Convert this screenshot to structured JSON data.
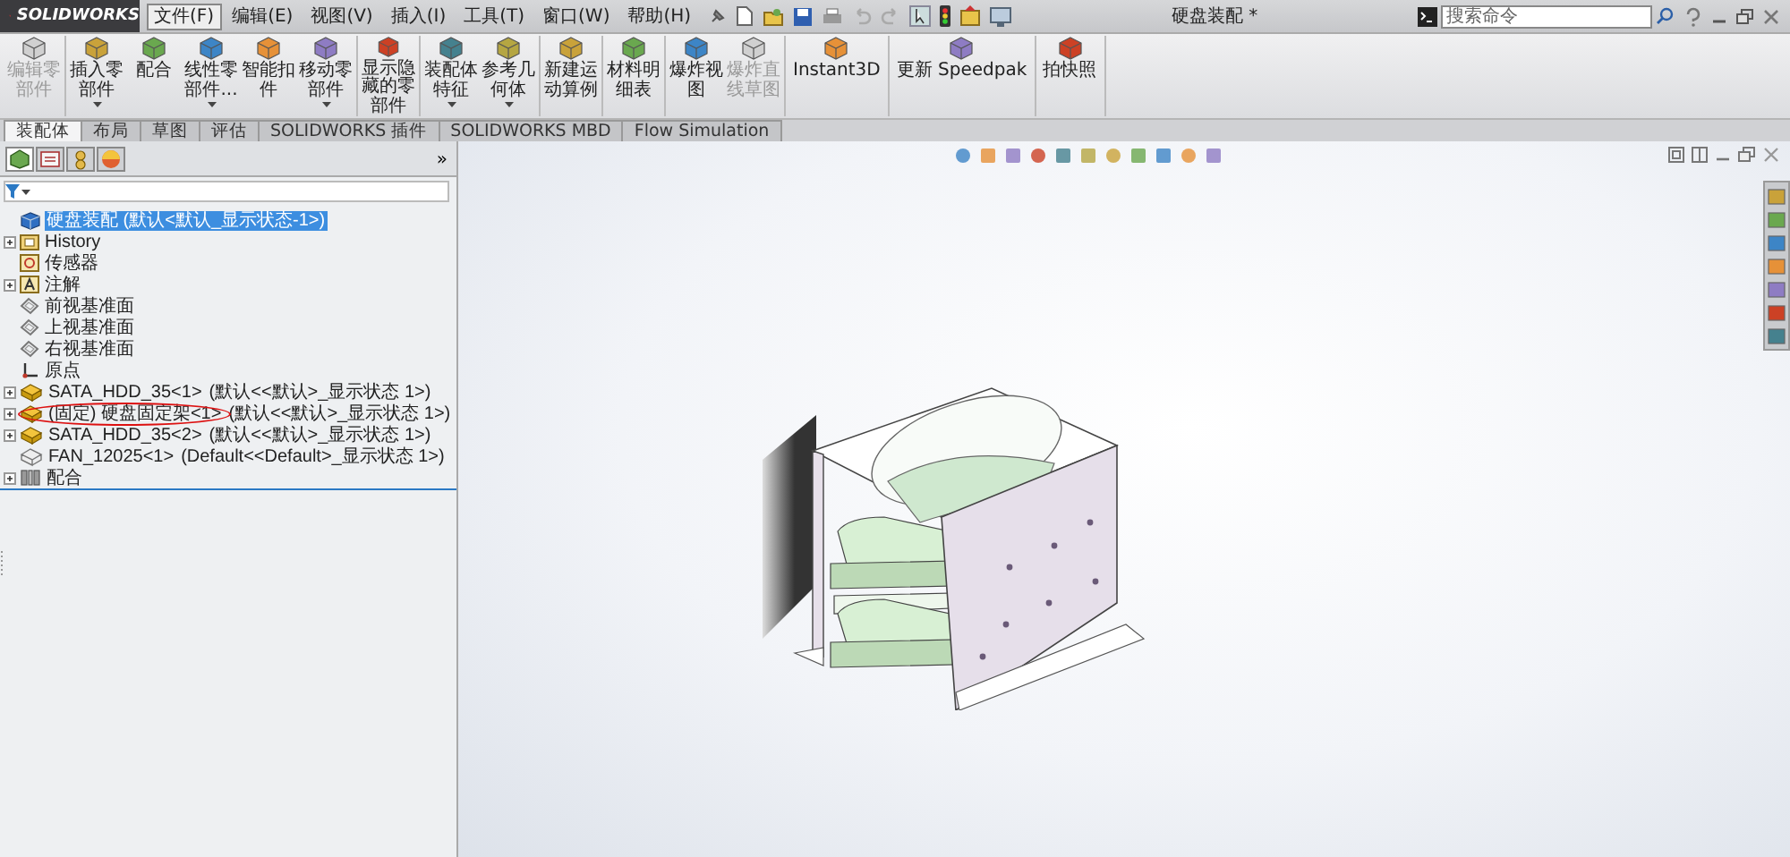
{
  "app": {
    "logo": "SOLIDWORKS"
  },
  "menu": [
    {
      "label": "文件(F)",
      "selected": true
    },
    {
      "label": "编辑(E)",
      "selected": false
    },
    {
      "label": "视图(V)",
      "selected": false
    },
    {
      "label": "插入(I)",
      "selected": false
    },
    {
      "label": "工具(T)",
      "selected": false
    },
    {
      "label": "窗口(W)",
      "selected": false
    },
    {
      "label": "帮助(H)",
      "selected": false
    }
  ],
  "window": {
    "title": "硬盘装配 *"
  },
  "search": {
    "placeholder": "搜索命令"
  },
  "ribbon": [
    [
      {
        "label": "编辑零部件",
        "disabled": true,
        "dropdown": false
      }
    ],
    [
      {
        "label": "插入零部件",
        "disabled": false,
        "dropdown": true
      },
      {
        "label": "配合",
        "disabled": false,
        "dropdown": false
      },
      {
        "label": "线性零部件...",
        "disabled": false,
        "dropdown": true
      },
      {
        "label": "智能扣件",
        "disabled": false,
        "dropdown": false
      },
      {
        "label": "移动零部件",
        "disabled": false,
        "dropdown": true
      }
    ],
    [
      {
        "label": "显示隐藏的零部件",
        "disabled": false,
        "dropdown": false
      }
    ],
    [
      {
        "label": "装配体特征",
        "disabled": false,
        "dropdown": true
      },
      {
        "label": "参考几何体",
        "disabled": false,
        "dropdown": true
      }
    ],
    [
      {
        "label": "新建运动算例",
        "disabled": false,
        "dropdown": false
      }
    ],
    [
      {
        "label": "材料明细表",
        "disabled": false,
        "dropdown": false
      }
    ],
    [
      {
        "label": "爆炸视图",
        "disabled": false,
        "dropdown": false
      },
      {
        "label": "爆炸直线草图",
        "disabled": true,
        "dropdown": false
      }
    ],
    [
      {
        "label": "Instant3D",
        "disabled": false,
        "dropdown": false
      }
    ],
    [
      {
        "label": "更新 Speedpak",
        "disabled": false,
        "dropdown": false
      }
    ],
    [
      {
        "label": "拍快照",
        "disabled": false,
        "dropdown": false
      }
    ]
  ],
  "tabs": [
    {
      "label": "装配体",
      "selected": true
    },
    {
      "label": "布局",
      "selected": false
    },
    {
      "label": "草图",
      "selected": false
    },
    {
      "label": "评估",
      "selected": false
    },
    {
      "label": "SOLIDWORKS 插件",
      "selected": false
    },
    {
      "label": "SOLIDWORKS MBD",
      "selected": false
    },
    {
      "label": "Flow Simulation",
      "selected": false
    }
  ],
  "panel": {
    "tabs": [
      {
        "kind": "tree",
        "selected": true
      },
      {
        "kind": "property",
        "selected": false
      },
      {
        "kind": "config",
        "selected": false
      },
      {
        "kind": "display",
        "selected": false
      }
    ],
    "more": "»"
  },
  "tree": [
    {
      "label": "硬盘装配 (默认<默认_显示状态-1>)",
      "kind": "assembly",
      "selected": true,
      "children": [
        {
          "label": "History",
          "kind": "history",
          "selected": false,
          "expanded": false
        },
        {
          "label": "传感器",
          "kind": "sensor",
          "selected": false
        },
        {
          "label": "注解",
          "kind": "annotation",
          "selected": false,
          "expanded": false
        },
        {
          "label": "前视基准面",
          "kind": "plane",
          "selected": false
        },
        {
          "label": "上视基准面",
          "kind": "plane",
          "selected": false
        },
        {
          "label": "右视基准面",
          "kind": "plane",
          "selected": false
        },
        {
          "label": "原点",
          "kind": "origin",
          "selected": false
        },
        {
          "label": "SATA_HDD_35<1>",
          "config": "(默认<<默认>_显示状态 1>)",
          "kind": "part",
          "selected": false,
          "expanded": false
        },
        {
          "label": "(固定) 硬盘固定架<1>",
          "config": "(默认<<默认>_显示状态 1>)",
          "kind": "part",
          "selected": false,
          "expanded": false,
          "circled": true
        },
        {
          "label": "SATA_HDD_35<2>",
          "config": "(默认<<默认>_显示状态 1>)",
          "kind": "part",
          "selected": false,
          "expanded": false
        },
        {
          "label": "FAN_12025<1>",
          "config": "(Default<<Default>_显示状态 1>)",
          "kind": "part-outline",
          "selected": false
        },
        {
          "label": "配合",
          "kind": "mates",
          "selected": false,
          "expanded": false
        }
      ]
    }
  ]
}
